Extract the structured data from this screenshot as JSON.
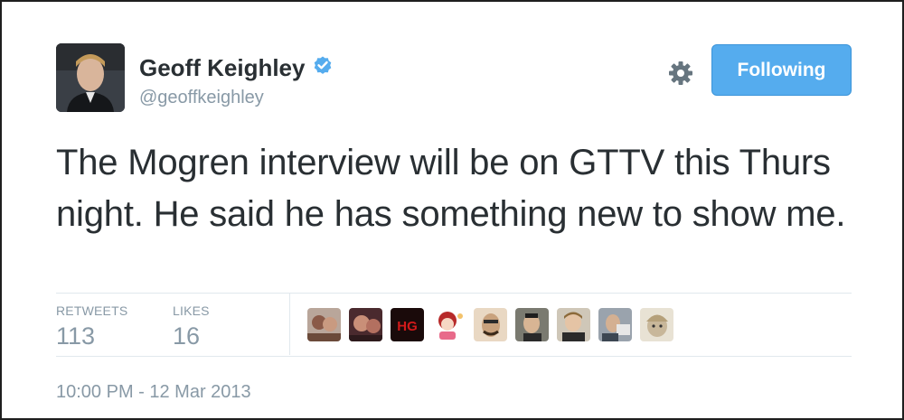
{
  "author": {
    "name": "Geoff Keighley",
    "handle": "@geoffkeighley",
    "verified": true
  },
  "actions": {
    "follow_label": "Following",
    "accent_color": "#55acee"
  },
  "tweet": {
    "text": "The Mogren interview will be on GTTV this Thurs night. He said he has something new to show me."
  },
  "stats": {
    "retweets_label": "RETWEETS",
    "retweets_count": "113",
    "likes_label": "LIKES",
    "likes_count": "16"
  },
  "likers": [
    {
      "id": "liker-1"
    },
    {
      "id": "liker-2"
    },
    {
      "id": "liker-3",
      "badge": "HG"
    },
    {
      "id": "liker-4"
    },
    {
      "id": "liker-5"
    },
    {
      "id": "liker-6"
    },
    {
      "id": "liker-7"
    },
    {
      "id": "liker-8"
    },
    {
      "id": "liker-9"
    }
  ],
  "timestamp": "10:00 PM - 12 Mar 2013",
  "icons": {
    "verified": "verified-badge-icon",
    "settings": "gear-icon"
  }
}
